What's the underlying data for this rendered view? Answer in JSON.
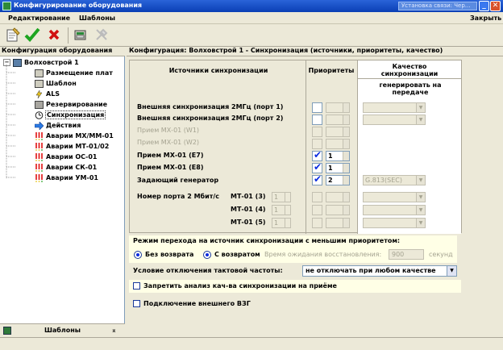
{
  "window": {
    "title": "Конфигурирование оборудования",
    "sync_status": "Установка связи: Чер...",
    "min": "_",
    "max": "▫",
    "close": "✕"
  },
  "menu": {
    "edit": "Редактирование",
    "templates": "Шаблоны",
    "close": "Закрыть"
  },
  "toolbar": {
    "icons": [
      "new-doc-icon",
      "apply-check-icon",
      "cancel-x-icon",
      "equipment-icon",
      "tools-icon"
    ]
  },
  "tree": {
    "header": "Конфигурация оборудования",
    "root": "Волховстрой 1",
    "items": [
      "Размещение плат",
      "Шаблон",
      "ALS",
      "Резервирование",
      "Синхронизация",
      "Действия",
      "Аварии МХ/ММ-01",
      "Аварии МТ-01/02",
      "Аварии ОС-01",
      "Аварии СК-01",
      "Аварии УМ-01"
    ],
    "selected_index": 4
  },
  "templates_bar": {
    "label": "Шаблоны",
    "toggle": "⌅"
  },
  "content": {
    "header": "Конфигурация: Волховстрой 1 - Синхронизация (источники, приоритеты, качество)"
  },
  "grid": {
    "col_sources": "Источники синхронизации",
    "col_priorities": "Приоритеты",
    "col_quality": "Качество синхронизации",
    "col_generate": "генерировать на передаче",
    "sources": [
      {
        "label": "Внешняя синхронизация 2МГц (порт 1)",
        "enabled": true,
        "checked": false,
        "priority": "",
        "quality": ""
      },
      {
        "label": "Внешняя синхронизация 2МГц (порт 2)",
        "enabled": true,
        "checked": false,
        "priority": "",
        "quality": ""
      },
      {
        "label": "Прием МХ-01 (W1)",
        "enabled": false,
        "checked": false,
        "priority": "",
        "quality": ""
      },
      {
        "label": "Прием МХ-01 (W2)",
        "enabled": false,
        "checked": false,
        "priority": "",
        "quality": ""
      },
      {
        "label": "Прием МХ-01 (E7)",
        "enabled": true,
        "checked": true,
        "priority": "1",
        "quality": ""
      },
      {
        "label": "Прием МХ-01 (E8)",
        "enabled": true,
        "checked": true,
        "priority": "1",
        "quality": ""
      },
      {
        "label": "Задающий генератор",
        "enabled": true,
        "checked": true,
        "priority": "2",
        "quality": "G.813(SEC)"
      }
    ],
    "port_label": "Номер порта 2 Мбит/с",
    "ports": [
      {
        "label": "МТ-01 (3)",
        "value": "1"
      },
      {
        "label": "МТ-01 (4)",
        "value": "1"
      },
      {
        "label": "МТ-01 (5)",
        "value": "1"
      }
    ]
  },
  "mode": {
    "title": "Режим перехода на источник синхронизации с меньшим приоритетом:",
    "opt1": "Без возврата",
    "opt2": "С возвратом",
    "wait_label": "Время ожидания восстановления:",
    "wait_value": "900",
    "wait_unit": "секунд"
  },
  "disable": {
    "label": "Условие отключения тактовой частоты:",
    "value": "не отключать при любом качестве"
  },
  "checks": {
    "forbid": "Запретить анализ кач-ва синхронизации на приёме",
    "external": "Подключение внешнего ВЗГ"
  }
}
